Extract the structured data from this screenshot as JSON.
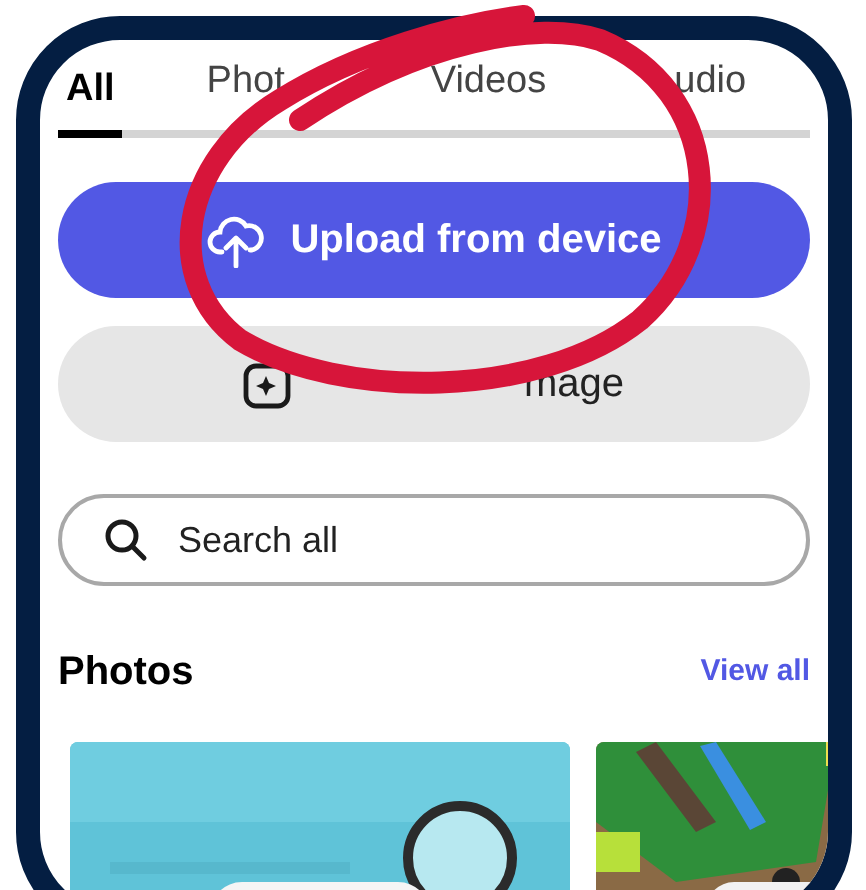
{
  "tabs": [
    {
      "label": "All",
      "selected": true
    },
    {
      "label": "Phot",
      "selected": false
    },
    {
      "label": "Videos",
      "selected": false
    },
    {
      "label": "udio",
      "selected": false
    }
  ],
  "primary_button": {
    "label": "Upload from device"
  },
  "secondary_button": {
    "label": "mage"
  },
  "search": {
    "placeholder": "Search all"
  },
  "section": {
    "title": "Photos",
    "link": "View all"
  }
}
